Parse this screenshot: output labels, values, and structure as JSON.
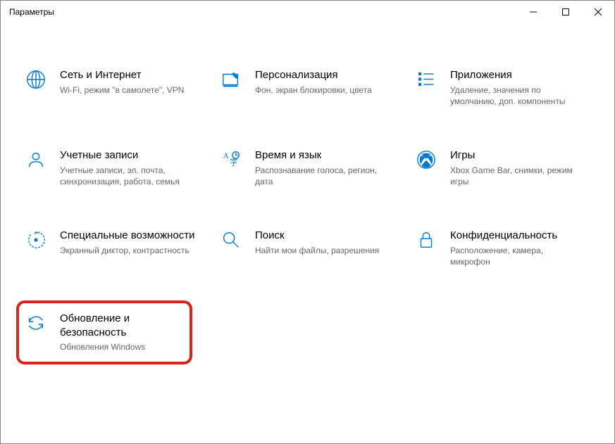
{
  "window": {
    "title": "Параметры"
  },
  "tiles": [
    {
      "title": "Сеть и Интернет",
      "desc": "Wi-Fi, режим \"в самолете\", VPN"
    },
    {
      "title": "Персонализация",
      "desc": "Фон, экран блокировки, цвета"
    },
    {
      "title": "Приложения",
      "desc": "Удаление, значения по умолчанию, доп. компоненты"
    },
    {
      "title": "Учетные записи",
      "desc": "Учетные записи, эл. почта, синхронизация, работа, семья"
    },
    {
      "title": "Время и язык",
      "desc": "Распознавание голоса, регион, дата"
    },
    {
      "title": "Игры",
      "desc": "Xbox Game Bar, снимки, режим игры"
    },
    {
      "title": "Специальные возможности",
      "desc": "Экранный диктор, контрастность"
    },
    {
      "title": "Поиск",
      "desc": "Найти мои файлы, разрешения"
    },
    {
      "title": "Конфиденциальность",
      "desc": "Расположение, камера, микрофон"
    },
    {
      "title": "Обновление и безопасность",
      "desc": "Обновления Windows"
    }
  ]
}
